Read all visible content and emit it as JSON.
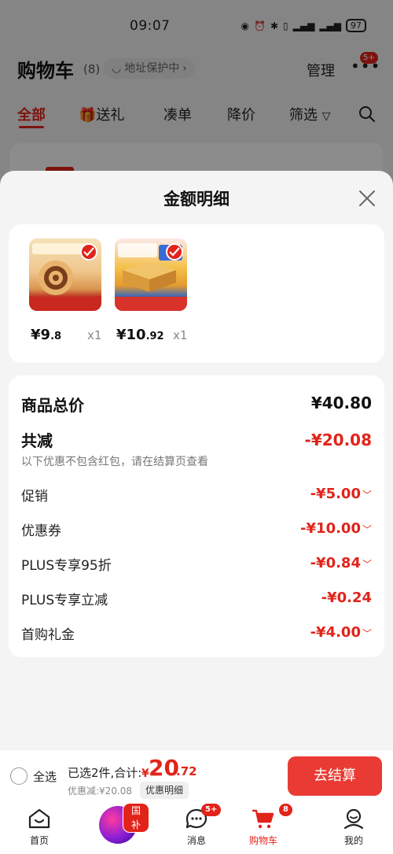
{
  "status_bar": {
    "time": "09:07",
    "battery": "97"
  },
  "header": {
    "title": "购物车",
    "count": "(8)",
    "address_chip": "地址保护中",
    "manage": "管理",
    "more_badge": "5+"
  },
  "tabs": [
    {
      "label": "全部"
    },
    {
      "label": "送礼"
    },
    {
      "label": "凑单"
    },
    {
      "label": "降价"
    },
    {
      "label": "筛选"
    }
  ],
  "sheet": {
    "title": "金额明细",
    "products": [
      {
        "price_int": "¥9",
        "price_dec": ".8",
        "qty": "x1"
      },
      {
        "price_int": "¥10",
        "price_dec": ".92",
        "qty": "x1"
      }
    ],
    "total_label": "商品总价",
    "total_value": "¥40.80",
    "reduce_label": "共减",
    "reduce_value": "-¥20.08",
    "reduce_note": "以下优惠不包含红包，请在结算页查看",
    "rows": [
      {
        "label": "促销",
        "value": "-¥5.00"
      },
      {
        "label": "优惠券",
        "value": "-¥10.00"
      },
      {
        "label": "PLUS专享95折",
        "value": "-¥0.84"
      },
      {
        "label": "PLUS专享立减",
        "value": "-¥0.24"
      },
      {
        "label": "首购礼金",
        "value": "-¥4.00"
      }
    ]
  },
  "checkout": {
    "select_all": "全选",
    "selected_text": "已选2件,合计:",
    "currency": "¥",
    "total_int": "20",
    "total_dec": ".72",
    "discount_text": "优惠减:¥20.08",
    "detail_chip": "优惠明细",
    "checkout_button": "去结算"
  },
  "bottom_nav": [
    {
      "label": "首页"
    },
    {
      "label": "",
      "badge": "国补"
    },
    {
      "label": "消息",
      "badge": "5+"
    },
    {
      "label": "购物车",
      "badge": "8"
    },
    {
      "label": "我的"
    }
  ],
  "colors": {
    "accent": "#e2231a",
    "button": "#e93b33"
  }
}
